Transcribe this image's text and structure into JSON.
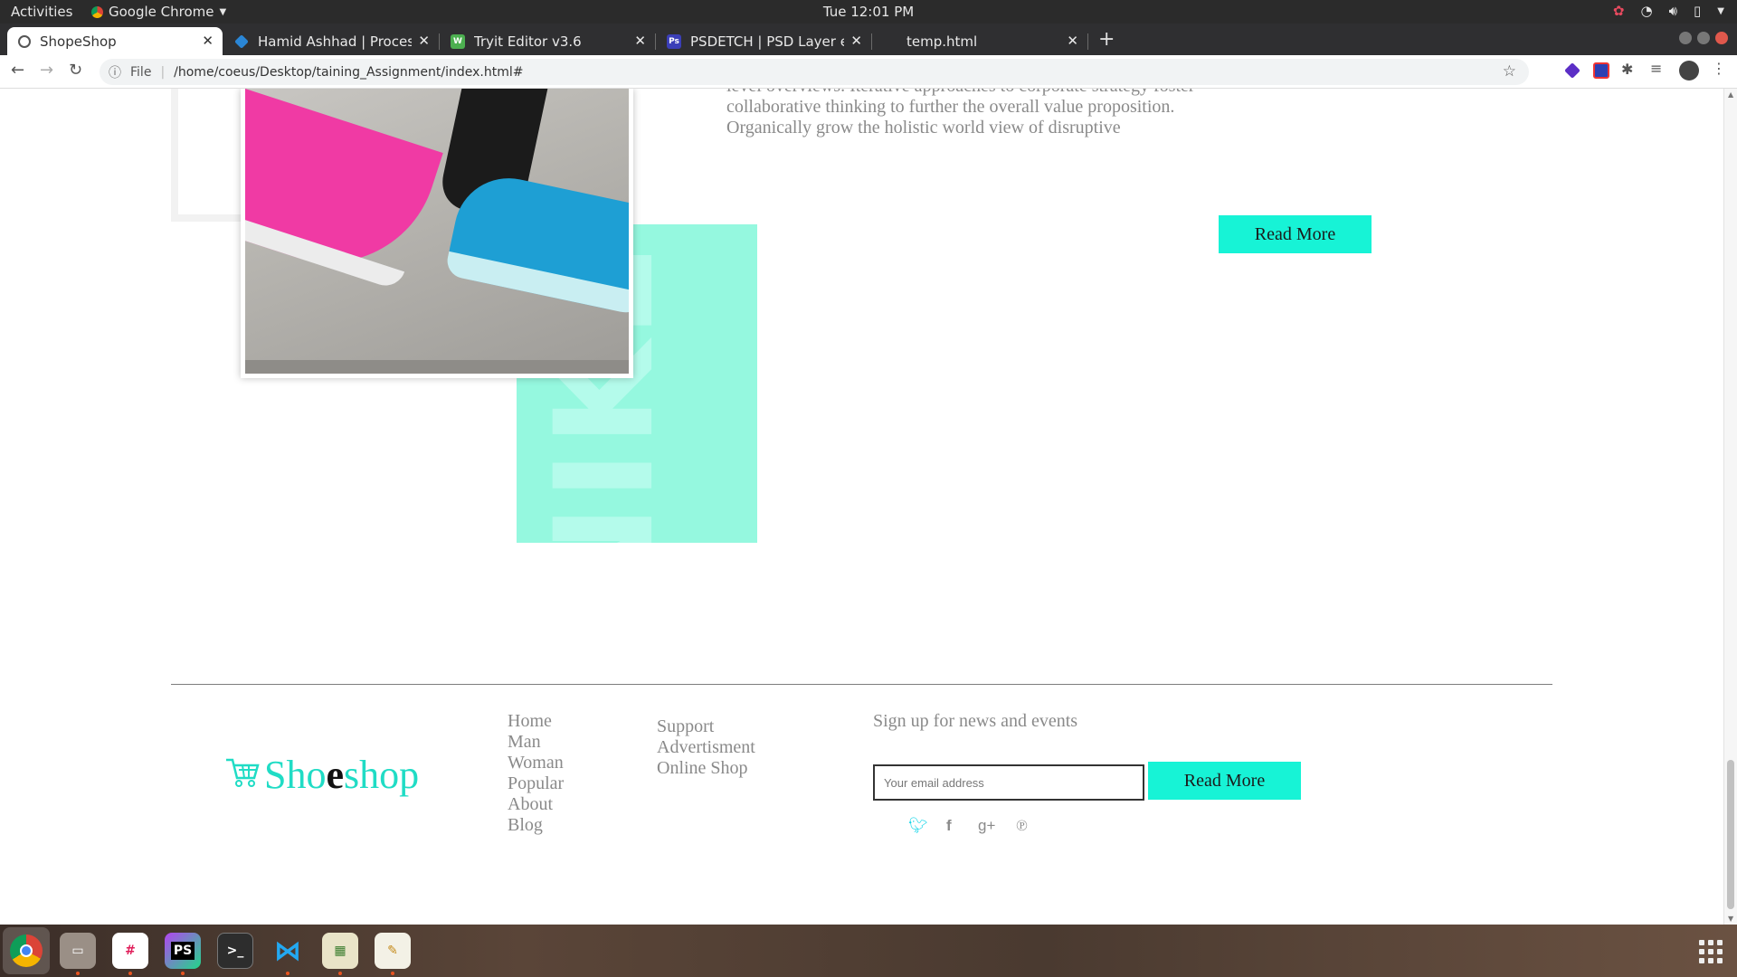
{
  "system_bar": {
    "activities": "Activities",
    "app_name": "Google Chrome",
    "clock": "Tue 12:01 PM"
  },
  "tabs": [
    {
      "title": "ShopeShop",
      "active": true
    },
    {
      "title": "Hamid Ashhad | Process S",
      "active": false
    },
    {
      "title": "Tryit Editor v3.6",
      "active": false
    },
    {
      "title": "PSDETCH | PSD Layer exp",
      "active": false
    },
    {
      "title": "temp.html",
      "active": false
    }
  ],
  "address_bar": {
    "scheme": "File",
    "url": "/home/coeus/Desktop/taining_Assignment/index.html#"
  },
  "content": {
    "paragraph_lines": [
      "level overviews. Iterative approaches to corporate strategy foster",
      "collaborative thinking to further the overall value proposition.",
      "Organically grow the holistic world view of disruptive"
    ],
    "read_more": "Read More",
    "brand_word": "NIKE"
  },
  "footer": {
    "logo": {
      "part1": "Sho",
      "part2": "e",
      "part3": "shop"
    },
    "nav_links": [
      "Home",
      "Man",
      "Woman",
      "Popular",
      "About",
      "Blog"
    ],
    "info_links": [
      "Support",
      "Advertisment",
      "Online Shop"
    ],
    "signup_title": "Sign up for news and events",
    "email_placeholder": "Your email address",
    "signup_button": "Read More",
    "social": [
      "twitter-icon",
      "facebook-icon",
      "google-plus-icon",
      "pinterest-icon"
    ]
  },
  "colors": {
    "accent": "#17f3d6",
    "accent_light": "#95f8df",
    "text_gray": "#8a8a8a"
  }
}
